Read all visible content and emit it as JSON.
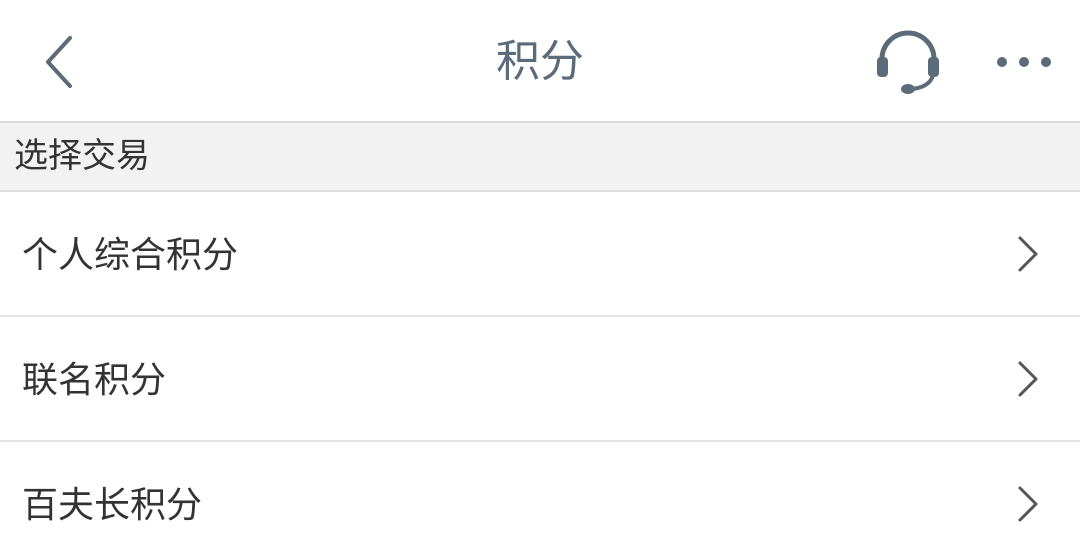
{
  "navbar": {
    "title": "积分",
    "icons": {
      "back": "chevron-left-icon",
      "support": "headset-icon",
      "more": "more-horizontal-icon"
    }
  },
  "section": {
    "header": "选择交易"
  },
  "list": {
    "items": [
      {
        "label": "个人综合积分"
      },
      {
        "label": "联名积分"
      },
      {
        "label": "百夫长积分"
      }
    ]
  },
  "colors": {
    "title_text": "#5c6b7a",
    "icon": "#5c6b7a",
    "body_text": "#333333",
    "section_background": "#f2f2f2",
    "divider": "#dcdcdc"
  }
}
